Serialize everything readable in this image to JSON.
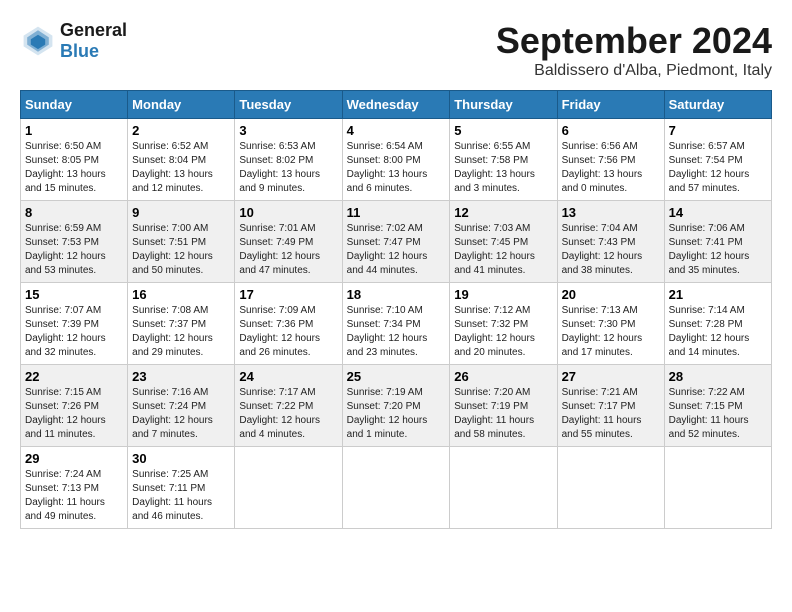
{
  "header": {
    "logo_line1": "General",
    "logo_line2": "Blue",
    "month_title": "September 2024",
    "location": "Baldissero d'Alba, Piedmont, Italy"
  },
  "weekdays": [
    "Sunday",
    "Monday",
    "Tuesday",
    "Wednesday",
    "Thursday",
    "Friday",
    "Saturday"
  ],
  "weeks": [
    [
      {
        "day": "1",
        "sunrise": "Sunrise: 6:50 AM",
        "sunset": "Sunset: 8:05 PM",
        "daylight": "Daylight: 13 hours and 15 minutes."
      },
      {
        "day": "2",
        "sunrise": "Sunrise: 6:52 AM",
        "sunset": "Sunset: 8:04 PM",
        "daylight": "Daylight: 13 hours and 12 minutes."
      },
      {
        "day": "3",
        "sunrise": "Sunrise: 6:53 AM",
        "sunset": "Sunset: 8:02 PM",
        "daylight": "Daylight: 13 hours and 9 minutes."
      },
      {
        "day": "4",
        "sunrise": "Sunrise: 6:54 AM",
        "sunset": "Sunset: 8:00 PM",
        "daylight": "Daylight: 13 hours and 6 minutes."
      },
      {
        "day": "5",
        "sunrise": "Sunrise: 6:55 AM",
        "sunset": "Sunset: 7:58 PM",
        "daylight": "Daylight: 13 hours and 3 minutes."
      },
      {
        "day": "6",
        "sunrise": "Sunrise: 6:56 AM",
        "sunset": "Sunset: 7:56 PM",
        "daylight": "Daylight: 13 hours and 0 minutes."
      },
      {
        "day": "7",
        "sunrise": "Sunrise: 6:57 AM",
        "sunset": "Sunset: 7:54 PM",
        "daylight": "Daylight: 12 hours and 57 minutes."
      }
    ],
    [
      {
        "day": "8",
        "sunrise": "Sunrise: 6:59 AM",
        "sunset": "Sunset: 7:53 PM",
        "daylight": "Daylight: 12 hours and 53 minutes."
      },
      {
        "day": "9",
        "sunrise": "Sunrise: 7:00 AM",
        "sunset": "Sunset: 7:51 PM",
        "daylight": "Daylight: 12 hours and 50 minutes."
      },
      {
        "day": "10",
        "sunrise": "Sunrise: 7:01 AM",
        "sunset": "Sunset: 7:49 PM",
        "daylight": "Daylight: 12 hours and 47 minutes."
      },
      {
        "day": "11",
        "sunrise": "Sunrise: 7:02 AM",
        "sunset": "Sunset: 7:47 PM",
        "daylight": "Daylight: 12 hours and 44 minutes."
      },
      {
        "day": "12",
        "sunrise": "Sunrise: 7:03 AM",
        "sunset": "Sunset: 7:45 PM",
        "daylight": "Daylight: 12 hours and 41 minutes."
      },
      {
        "day": "13",
        "sunrise": "Sunrise: 7:04 AM",
        "sunset": "Sunset: 7:43 PM",
        "daylight": "Daylight: 12 hours and 38 minutes."
      },
      {
        "day": "14",
        "sunrise": "Sunrise: 7:06 AM",
        "sunset": "Sunset: 7:41 PM",
        "daylight": "Daylight: 12 hours and 35 minutes."
      }
    ],
    [
      {
        "day": "15",
        "sunrise": "Sunrise: 7:07 AM",
        "sunset": "Sunset: 7:39 PM",
        "daylight": "Daylight: 12 hours and 32 minutes."
      },
      {
        "day": "16",
        "sunrise": "Sunrise: 7:08 AM",
        "sunset": "Sunset: 7:37 PM",
        "daylight": "Daylight: 12 hours and 29 minutes."
      },
      {
        "day": "17",
        "sunrise": "Sunrise: 7:09 AM",
        "sunset": "Sunset: 7:36 PM",
        "daylight": "Daylight: 12 hours and 26 minutes."
      },
      {
        "day": "18",
        "sunrise": "Sunrise: 7:10 AM",
        "sunset": "Sunset: 7:34 PM",
        "daylight": "Daylight: 12 hours and 23 minutes."
      },
      {
        "day": "19",
        "sunrise": "Sunrise: 7:12 AM",
        "sunset": "Sunset: 7:32 PM",
        "daylight": "Daylight: 12 hours and 20 minutes."
      },
      {
        "day": "20",
        "sunrise": "Sunrise: 7:13 AM",
        "sunset": "Sunset: 7:30 PM",
        "daylight": "Daylight: 12 hours and 17 minutes."
      },
      {
        "day": "21",
        "sunrise": "Sunrise: 7:14 AM",
        "sunset": "Sunset: 7:28 PM",
        "daylight": "Daylight: 12 hours and 14 minutes."
      }
    ],
    [
      {
        "day": "22",
        "sunrise": "Sunrise: 7:15 AM",
        "sunset": "Sunset: 7:26 PM",
        "daylight": "Daylight: 12 hours and 11 minutes."
      },
      {
        "day": "23",
        "sunrise": "Sunrise: 7:16 AM",
        "sunset": "Sunset: 7:24 PM",
        "daylight": "Daylight: 12 hours and 7 minutes."
      },
      {
        "day": "24",
        "sunrise": "Sunrise: 7:17 AM",
        "sunset": "Sunset: 7:22 PM",
        "daylight": "Daylight: 12 hours and 4 minutes."
      },
      {
        "day": "25",
        "sunrise": "Sunrise: 7:19 AM",
        "sunset": "Sunset: 7:20 PM",
        "daylight": "Daylight: 12 hours and 1 minute."
      },
      {
        "day": "26",
        "sunrise": "Sunrise: 7:20 AM",
        "sunset": "Sunset: 7:19 PM",
        "daylight": "Daylight: 11 hours and 58 minutes."
      },
      {
        "day": "27",
        "sunrise": "Sunrise: 7:21 AM",
        "sunset": "Sunset: 7:17 PM",
        "daylight": "Daylight: 11 hours and 55 minutes."
      },
      {
        "day": "28",
        "sunrise": "Sunrise: 7:22 AM",
        "sunset": "Sunset: 7:15 PM",
        "daylight": "Daylight: 11 hours and 52 minutes."
      }
    ],
    [
      {
        "day": "29",
        "sunrise": "Sunrise: 7:24 AM",
        "sunset": "Sunset: 7:13 PM",
        "daylight": "Daylight: 11 hours and 49 minutes."
      },
      {
        "day": "30",
        "sunrise": "Sunrise: 7:25 AM",
        "sunset": "Sunset: 7:11 PM",
        "daylight": "Daylight: 11 hours and 46 minutes."
      },
      null,
      null,
      null,
      null,
      null
    ]
  ]
}
